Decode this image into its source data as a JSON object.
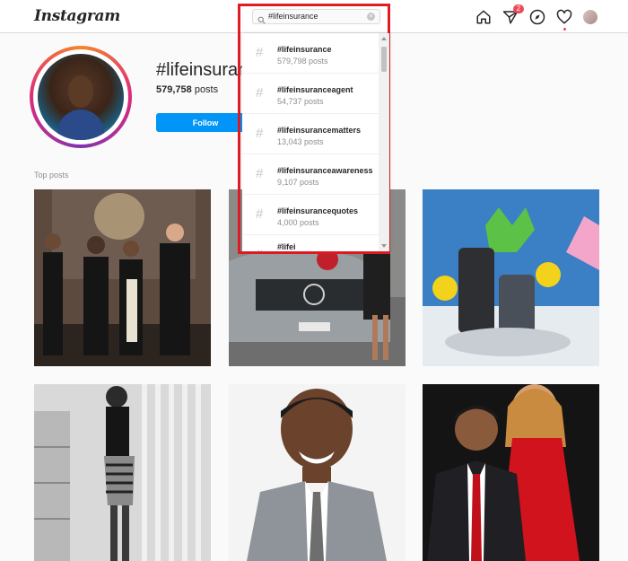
{
  "app": {
    "logo": "Instagram"
  },
  "nav": {
    "notifications_badge": "2"
  },
  "search": {
    "value": "#lifeinsurance"
  },
  "suggestions": [
    {
      "tag": "#lifeinsurance",
      "posts": "579,798 posts"
    },
    {
      "tag": "#lifeinsuranceagent",
      "posts": "54,737 posts"
    },
    {
      "tag": "#lifeinsurancematters",
      "posts": "13,043 posts"
    },
    {
      "tag": "#lifeinsuranceawareness",
      "posts": "9,107 posts"
    },
    {
      "tag": "#lifeinsurancequotes",
      "posts": "4,000 posts"
    },
    {
      "tag": "#lifei",
      "posts": ""
    }
  ],
  "header": {
    "title": "#lifeinsurance",
    "post_count": "579,758",
    "post_label": " posts",
    "follow_label": "Follow"
  },
  "section": {
    "top_posts_label": "Top posts"
  },
  "colors": {
    "accent": "#0095f6",
    "highlight_frame": "#e01b24",
    "badge": "#ed4956"
  },
  "icons": [
    "home-icon",
    "direct-icon",
    "explore-icon",
    "heart-icon",
    "search-icon",
    "clear-icon"
  ]
}
